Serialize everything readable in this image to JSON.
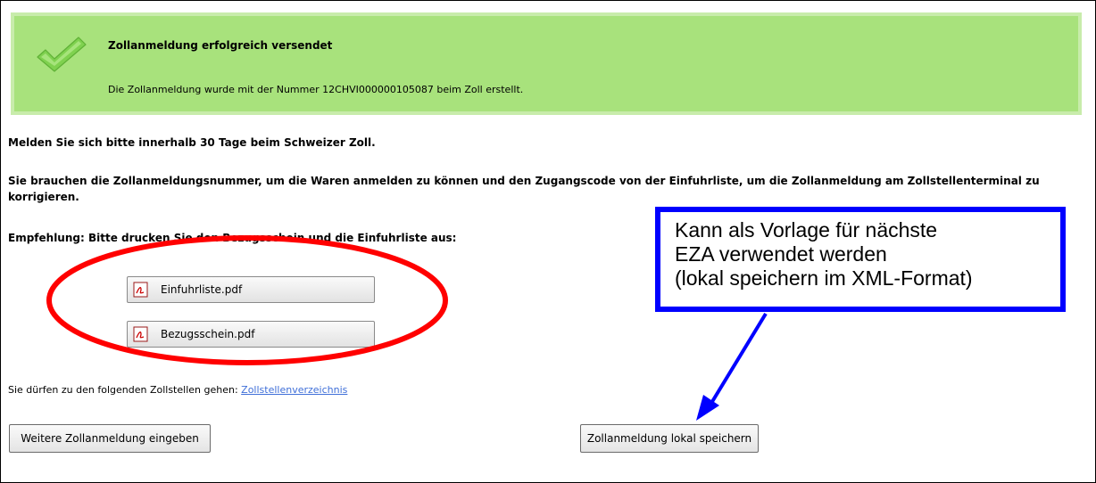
{
  "banner": {
    "title": "Zollanmeldung erfolgreich versendet",
    "message": "Die Zollanmeldung wurde mit der Nummer 12CHVI000000105087 beim Zoll erstellt."
  },
  "content": {
    "notice": "Melden Sie sich bitte innerhalb 30 Tage beim Schweizer Zoll.",
    "info_line1": "Sie brauchen die Zollanmeldungsnummer, um die Waren anmelden zu können und den Zugangscode von der Einfuhrliste, um die Zollanmeldung am Zollstellenterminal zu",
    "info_line2": "korrigieren.",
    "recommendation": "Empfehlung: Bitte drucken Sie den Bezugsschein und die Einfuhrliste aus:",
    "pdf_buttons": [
      "Einfuhrliste.pdf",
      "Bezugsschein.pdf"
    ],
    "offices_text": "Sie dürfen zu den folgenden Zollstellen gehen:",
    "offices_link": "Zollstellenverzeichnis"
  },
  "actions": {
    "more_label": "Weitere Zollanmeldung eingeben",
    "save_label": "Zollanmeldung lokal speichern"
  },
  "annotation": {
    "line1": "Kann als Vorlage für nächste",
    "line2": "EZA verwendet werden",
    "line3": "(lokal speichern im XML-Format)",
    "box_color": "#0000ff",
    "ellipse_color": "#ff0000"
  },
  "colors": {
    "banner_bg": "#a8e27c",
    "link": "#3f6fd8"
  }
}
